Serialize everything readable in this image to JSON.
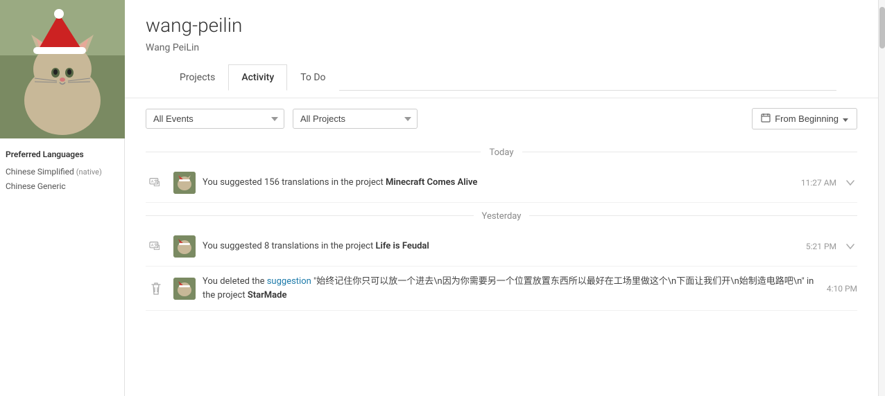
{
  "sidebar": {
    "preferred_languages_label": "Preferred Languages",
    "languages": [
      {
        "name": "Chinese Simplified",
        "note": "(native)"
      },
      {
        "name": "Chinese Generic",
        "note": ""
      }
    ]
  },
  "profile": {
    "username": "wang-peilin",
    "realname": "Wang PeiLin"
  },
  "tabs": [
    {
      "id": "projects",
      "label": "Projects",
      "active": false
    },
    {
      "id": "activity",
      "label": "Activity",
      "active": true
    },
    {
      "id": "todo",
      "label": "To Do",
      "active": false
    }
  ],
  "filters": {
    "events_label": "All Events",
    "projects_label": "All Projects",
    "date_label": "From Beginning",
    "events_placeholder": "All Events",
    "projects_placeholder": "All Projects"
  },
  "activity": {
    "sections": [
      {
        "day": "Today",
        "items": [
          {
            "type": "translation",
            "text_prefix": "You suggested 156 translations in the project ",
            "project": "Minecraft Comes Alive",
            "time": "11:27 AM",
            "has_expand": true
          }
        ]
      },
      {
        "day": "Yesterday",
        "items": [
          {
            "type": "translation",
            "text_prefix": "You suggested 8 translations in the project ",
            "project": "Life is Feudal",
            "time": "5:21 PM",
            "has_expand": true
          },
          {
            "type": "delete",
            "text_prefix": "You deleted the ",
            "link_text": "suggestion",
            "text_middle": " “始终记住你只可以放一个进去\\n因为你需要另一个位置放置东西所以最好在工场里做这个\\n下面让我们开\\n始制造电路吧\\n” in the project ",
            "project": "StarMade",
            "time": "4:10 PM",
            "has_expand": false
          }
        ]
      }
    ]
  }
}
